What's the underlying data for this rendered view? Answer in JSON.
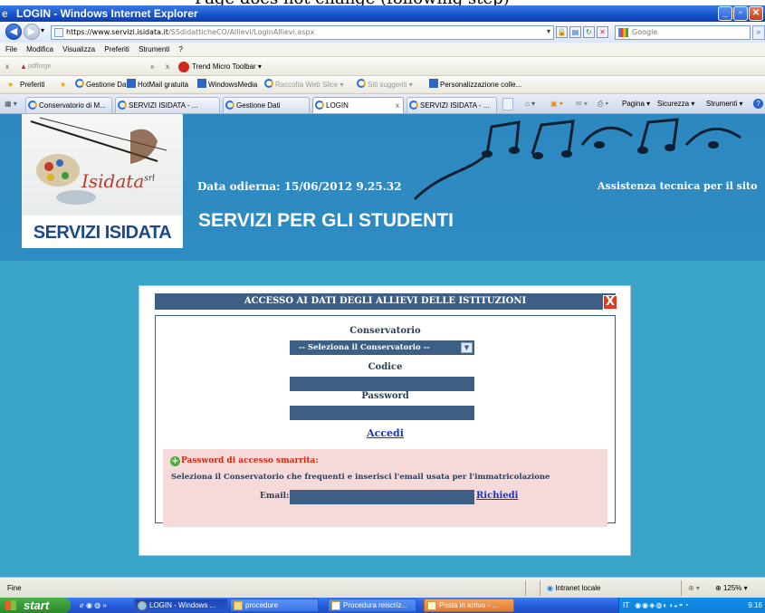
{
  "window": {
    "title": "LOGIN - Windows Internet Explorer",
    "top_cut_text": "Page does not change (following step)"
  },
  "address_bar": {
    "url_prefix": "https://www.servizi.",
    "url_domain": "isidata.it",
    "url_path": "/SSdidatticheCO/Allievi/LoginAllievi.aspx",
    "search_placeholder": "Google"
  },
  "menu": [
    "File",
    "Modifica",
    "Visualizza",
    "Preferiti",
    "Strumenti",
    "?"
  ],
  "toolbar1": {
    "pdfforge": "pdfforge",
    "trend_micro": "Trend Micro Toolbar"
  },
  "favorites_bar": {
    "favorites_label": "Preferiti",
    "items": [
      "Gestione Dati",
      "HotMail gratuita",
      "WindowsMedia",
      "Raccolta Web Slice",
      "Siti suggeriti",
      "Personalizzazione colle..."
    ]
  },
  "tabs": [
    {
      "label": "Conservatorio di M..."
    },
    {
      "label": "SERVIZI ISIDATA - ..."
    },
    {
      "label": "Gestione Dati"
    },
    {
      "label": "LOGIN"
    },
    {
      "label": "SERVIZI ISIDATA - ..."
    }
  ],
  "command_bar": {
    "pagina": "Pagina",
    "sicurezza": "Sicurezza",
    "strumenti": "Strumenti"
  },
  "page": {
    "logo_text": "SERVIZI ISIDATA",
    "logo_brand": "Isidata",
    "logo_brand_suffix": "srl",
    "date_label": "Data odierna: 15/06/2012 9.25.32",
    "assistance": "Assistenza tecnica per il sito",
    "heading": "SERVIZI PER GLI STUDENTI"
  },
  "dialog": {
    "title": "ACCESSO AI DATI DEGLI ALLIEVI DELLE ISTITUZIONI",
    "close_glyph": "X",
    "conservatorio_label": "Conservatorio",
    "conservatorio_selected": "-- Seleziona il Conservatorio --",
    "codice_label": "Codice",
    "password_label": "Password",
    "accedi": "Accedi",
    "recovery": {
      "title": "Password di accesso smarrita:",
      "description": "Seleziona il Conservatorio che frequenti e inserisci l'email usata per l'immatricolazione",
      "email_label": "Email:",
      "request": "Richiedi"
    }
  },
  "statusbar": {
    "left": "Fine",
    "zone": "Intranet locale",
    "zoom": "125%"
  },
  "taskbar": {
    "start": "start",
    "tasks": [
      "LOGIN - Windows ...",
      "procedure",
      "Procedura reiscriz...",
      "Posta in arrivo - ..."
    ],
    "lang": "IT",
    "time": "9.16"
  }
}
